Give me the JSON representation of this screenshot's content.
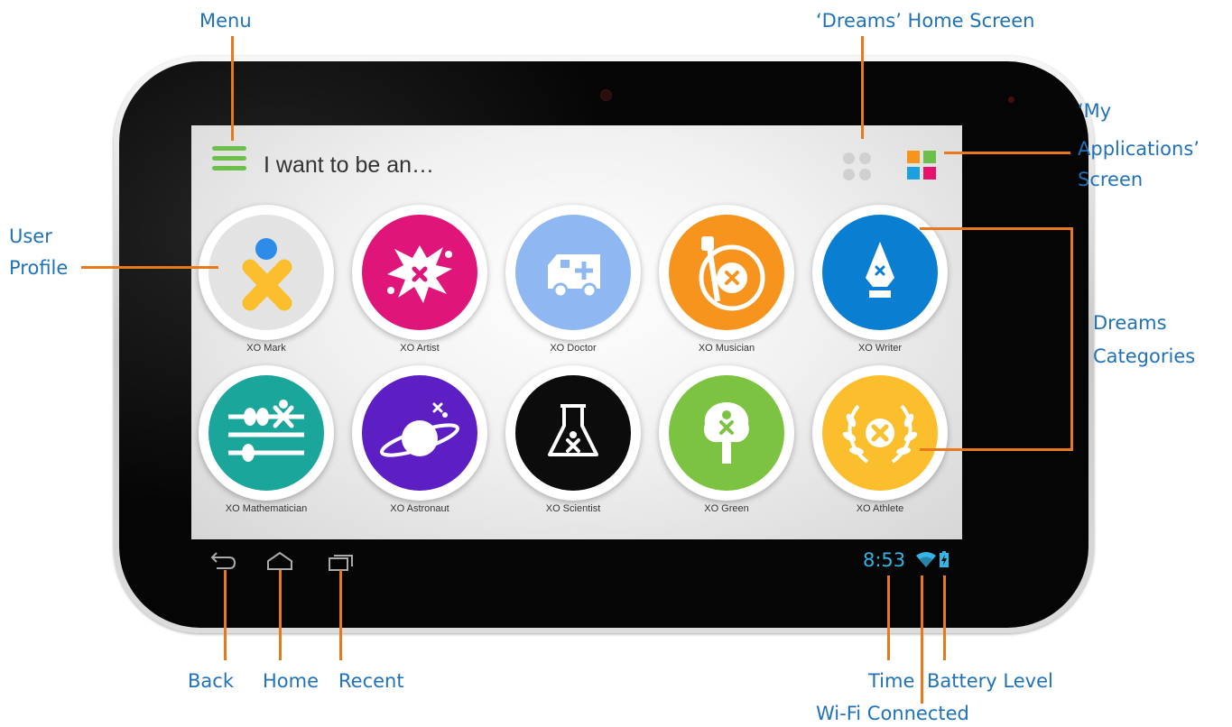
{
  "annotations": {
    "menu": "Menu",
    "dreams_home_screen": "‘Dreams’ Home Screen",
    "my_applications_line1": "‘My",
    "my_applications_line2": "Applications’",
    "my_applications_line3": "Screen",
    "user_profile_line1": "User",
    "user_profile_line2": "Profile",
    "dreams_categories_line1": "Dreams",
    "dreams_categories_line2": "Categories",
    "back": "Back",
    "home": "Home",
    "recent": "Recent",
    "time": "Time",
    "battery_level": "Battery Level",
    "wifi_connected": "Wi-Fi Connected"
  },
  "header": {
    "title": "I want to be an…"
  },
  "app_grid_squares": [
    "#f7941d",
    "#6cc04a",
    "#1ba1e2",
    "#e6136c"
  ],
  "categories": [
    {
      "label": "XO Mark",
      "icon": "xo-user-icon",
      "color": "#e3e3e3"
    },
    {
      "label": "XO Artist",
      "icon": "paint-splash-icon",
      "color": "#e0157a"
    },
    {
      "label": "XO Doctor",
      "icon": "ambulance-icon",
      "color": "#8fb8f2"
    },
    {
      "label": "XO Musician",
      "icon": "guitar-icon",
      "color": "#f7941d"
    },
    {
      "label": "XO Writer",
      "icon": "pen-nib-icon",
      "color": "#0a7fd1"
    },
    {
      "label": "XO Mathematician",
      "icon": "abacus-icon",
      "color": "#1aa69a"
    },
    {
      "label": "XO Astronaut",
      "icon": "planet-icon",
      "color": "#5d1fc4"
    },
    {
      "label": "XO Scientist",
      "icon": "flask-icon",
      "color": "#0c0c0c"
    },
    {
      "label": "XO Green",
      "icon": "tree-icon",
      "color": "#7cc342"
    },
    {
      "label": "XO Athlete",
      "icon": "laurel-wreath-icon",
      "color": "#fbbf2e"
    }
  ],
  "status_bar": {
    "time": "8:53",
    "wifi_icon": "wifi-icon",
    "battery_icon": "battery-charging-icon",
    "color": "#33b5e5"
  },
  "nav_buttons": {
    "back_icon": "back-icon",
    "home_icon": "home-icon",
    "recent_icon": "recent-apps-icon"
  },
  "accent_line_color": "#e6781e",
  "annotation_text_color": "#1f72b8"
}
